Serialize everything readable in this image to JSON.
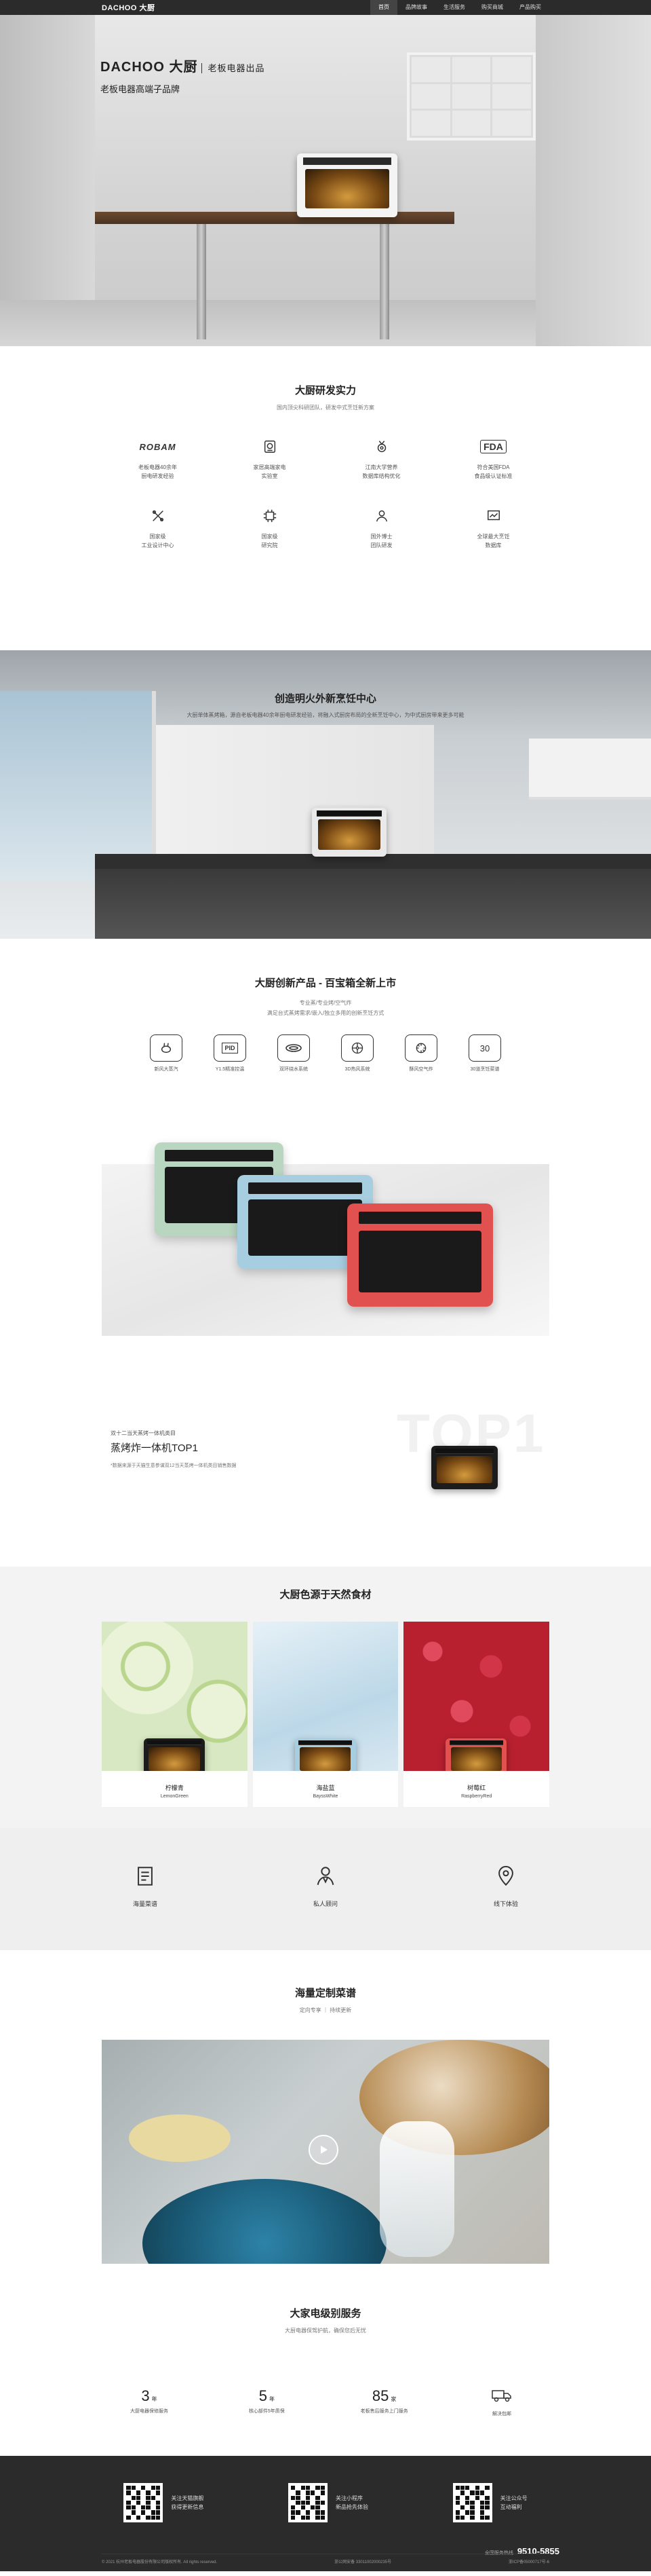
{
  "header": {
    "logo": "DACHOO 大厨",
    "nav": [
      "首页",
      "品牌故事",
      "生活服务",
      "购买商城",
      "产品购买"
    ]
  },
  "hero": {
    "brand_line": "DACHOO 大厨",
    "brand_tag": "老板电器出品",
    "slogan": "老板电器高端子品牌"
  },
  "rd": {
    "title": "大厨研发实力",
    "subtitle": "国内顶尖科研团队，研发中式烹饪新方案",
    "items": [
      {
        "icon": "robam-logo",
        "label": "ROBAM",
        "text": "老板电器40余年\n厨电研发经验"
      },
      {
        "icon": "lab-icon",
        "label": "",
        "text": "家居高端家电\n实验室"
      },
      {
        "icon": "medal-icon",
        "label": "",
        "text": "江南大学营养\n数据库结构优化"
      },
      {
        "icon": "fda-icon",
        "label": "FDA",
        "text": "符合美国FDA\n食品级认证标准"
      },
      {
        "icon": "tools-icon",
        "label": "",
        "text": "国家级\n工业设计中心"
      },
      {
        "icon": "chip-icon",
        "label": "",
        "text": "国家级\n研究院"
      },
      {
        "icon": "team-icon",
        "label": "",
        "text": "国外博士\n团队研发"
      },
      {
        "icon": "chart-icon",
        "label": "",
        "text": "全球最大烹饪\n数据库"
      }
    ]
  },
  "kitchen": {
    "title": "创造明火外新烹饪中心",
    "subtitle": "大厨单体蒸烤箱，源自老板电器40余年厨电研发经验，将融入式厨房布局的全新烹饪中心，为中式厨房带来更多可能"
  },
  "product": {
    "title": "大厨创新产品 - 百宝箱全新上市",
    "subtitle1": "专业蒸/专业烤/空气炸",
    "subtitle2": "满足台式蒸烤需求/嵌入/独立多用的创新烹饪方式",
    "features": [
      {
        "icon": "steam-icon",
        "text": "新风大蒸汽"
      },
      {
        "icon": "pid-icon",
        "text": "Y1.5精准控温",
        "label": "PID"
      },
      {
        "icon": "ring-icon",
        "text": "双环绕水系统"
      },
      {
        "icon": "fan-icon",
        "text": "3D热风系统"
      },
      {
        "icon": "airfry-icon",
        "text": "酥风空气炸"
      },
      {
        "icon": "menu-icon",
        "text": "30道烹饪菜谱",
        "label": "30"
      }
    ],
    "oven_colors": [
      "#b8d6c0",
      "#a7cde0",
      "#e0514f"
    ]
  },
  "top1": {
    "bg_text": "TOP1",
    "eyebrow": "双十二当天蒸烤一体机类目",
    "headline": "蒸烤炸一体机TOP1",
    "note": "*数据来源于天猫生意参谋双12当天蒸烤一体机类目销售数据"
  },
  "colors": {
    "title": "大厨色源于天然食材",
    "items": [
      {
        "name": "柠檬青",
        "en": "LemonGreen",
        "bg": "#cfe3b9"
      },
      {
        "name": "海盐蓝",
        "en": "BayssWhite",
        "bg": "#cfe3ee"
      },
      {
        "name": "树莓红",
        "en": "RaspberryRed",
        "bg": "#c8283c"
      }
    ]
  },
  "services": [
    {
      "icon": "book-icon",
      "text": "海量菜谱"
    },
    {
      "icon": "chef-icon",
      "text": "私人顾问"
    },
    {
      "icon": "location-icon",
      "text": "线下体验"
    }
  ],
  "recipe": {
    "title": "海量定制菜谱",
    "subtitle": "定向专享 ｜ 持续更新"
  },
  "vip": {
    "title": "大家电级别服务",
    "subtitle": "大厨电器保驾护航，确保您后无忧",
    "items": [
      {
        "num": "3",
        "unit": "年",
        "text": "大厨电器保修服务"
      },
      {
        "num": "5",
        "unit": "年",
        "text": "核心部件5年质保"
      },
      {
        "num": "85",
        "unit": "家",
        "text": "老板售后服务上门服务"
      },
      {
        "icon": "truck-icon",
        "num": "",
        "unit": "",
        "text": "解决包邮"
      }
    ]
  },
  "footer": {
    "qrs": [
      {
        "line1": "关注天猫旗舰",
        "line2": "获得更新信息"
      },
      {
        "line1": "关注小程序",
        "line2": "新品抢先体验"
      },
      {
        "line1": "关注公众号",
        "line2": "互动福利"
      }
    ],
    "phone": "9510-5855",
    "copyright": "© 2021 杭州老板电器股份有限公司版权所有. All rights reserved.",
    "icp1": "浙公网安备 33011002000235号",
    "icp2": "浙ICP备05000717号-6",
    "service_label": "全国服务热线"
  }
}
